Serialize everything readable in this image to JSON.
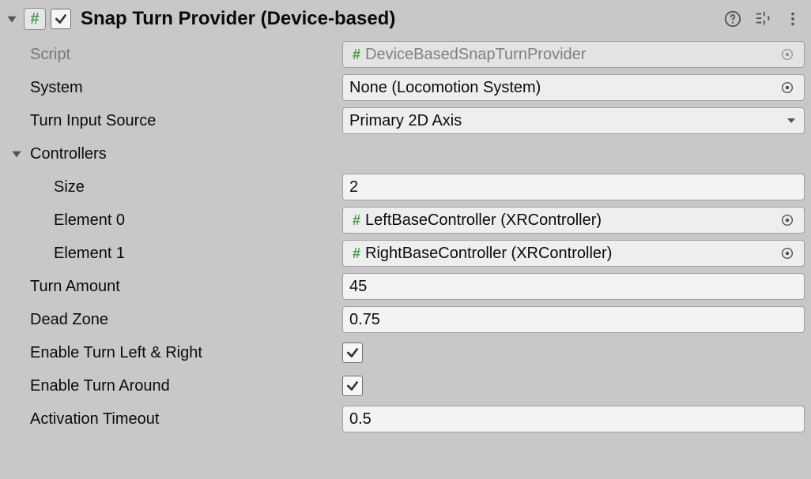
{
  "header": {
    "title": "Snap Turn Provider (Device-based)",
    "enabled": true,
    "foldout_open": true
  },
  "fields": {
    "script": {
      "label": "Script",
      "value": "DeviceBasedSnapTurnProvider"
    },
    "system": {
      "label": "System",
      "value": "None (Locomotion System)"
    },
    "turn_input_source": {
      "label": "Turn Input Source",
      "value": "Primary 2D Axis"
    },
    "controllers": {
      "label": "Controllers",
      "size_label": "Size",
      "size": "2",
      "elements": [
        {
          "label": "Element 0",
          "value": "LeftBaseController (XRController)"
        },
        {
          "label": "Element 1",
          "value": "RightBaseController (XRController)"
        }
      ]
    },
    "turn_amount": {
      "label": "Turn Amount",
      "value": "45"
    },
    "dead_zone": {
      "label": "Dead Zone",
      "value": "0.75"
    },
    "enable_turn_lr": {
      "label": "Enable Turn Left & Right",
      "value": true
    },
    "enable_turn_around": {
      "label": "Enable Turn Around",
      "value": true
    },
    "activation_timeout": {
      "label": "Activation Timeout",
      "value": "0.5"
    }
  }
}
